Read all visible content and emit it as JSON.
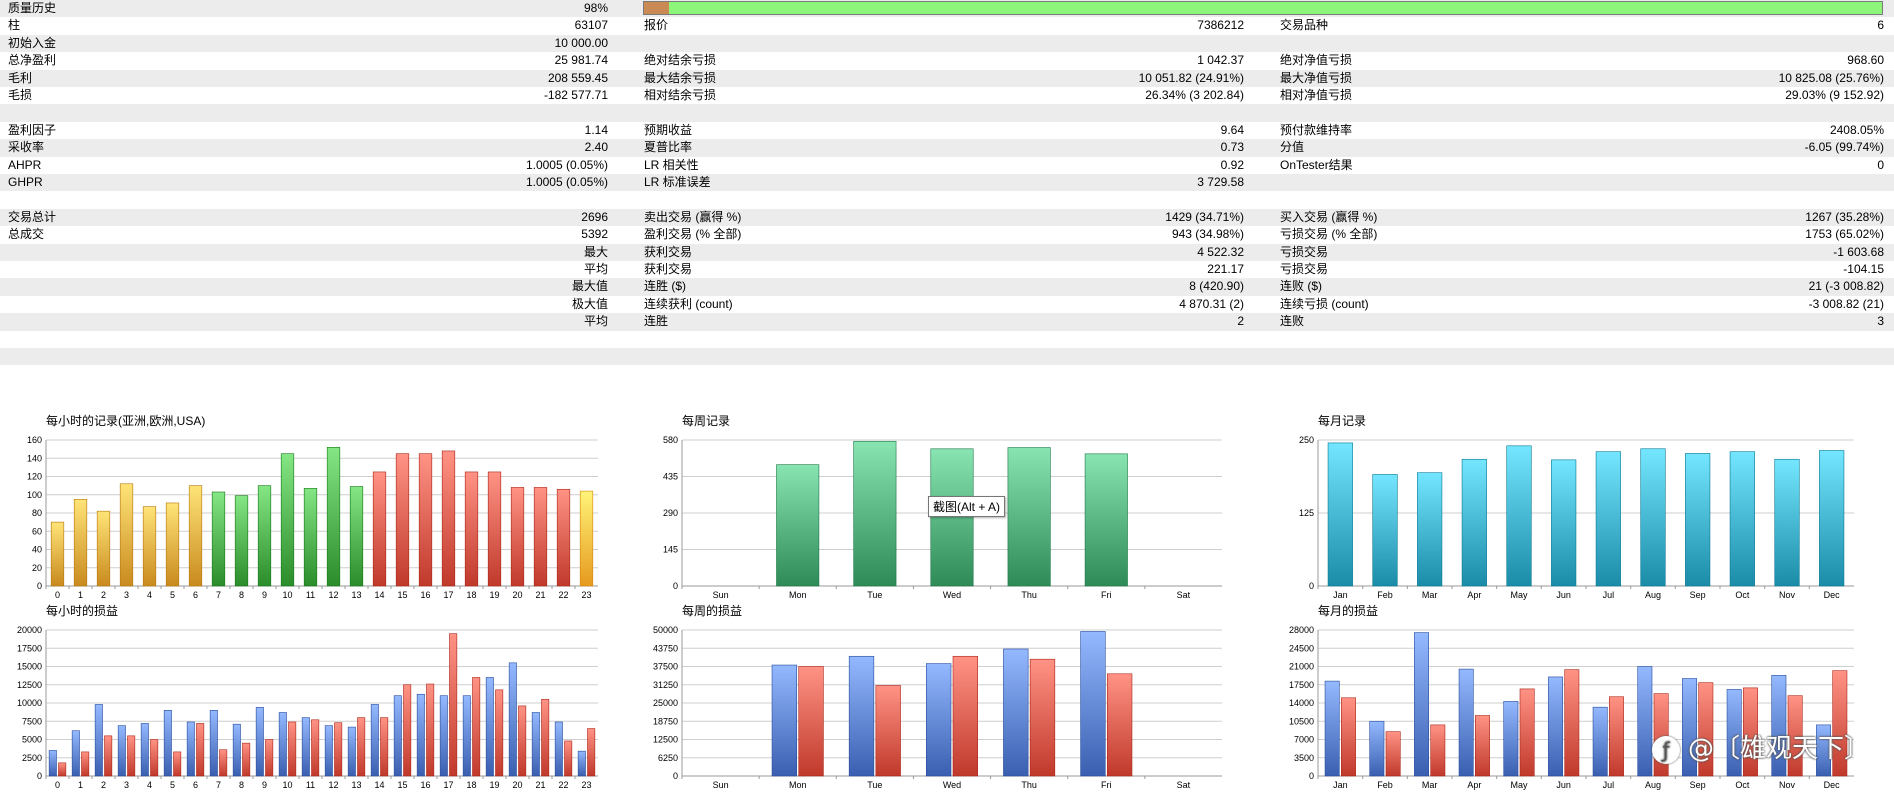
{
  "stats": {
    "rows": [
      {
        "shaded": true,
        "c1_label": "质量历史",
        "c1_value": "98%",
        "quality_bar": 0.98
      },
      {
        "shaded": false,
        "c1_label": "柱",
        "c1_value": "63107",
        "c2_label": "报价",
        "c2_value": "7386212",
        "c3_label": "交易品种",
        "c3_value": "6"
      },
      {
        "shaded": true,
        "c1_label": "初始入金",
        "c1_value": "10 000.00"
      },
      {
        "shaded": false,
        "c1_label": "总净盈利",
        "c1_value": "25 981.74",
        "c2_label": "绝对结余亏损",
        "c2_value": "1 042.37",
        "c3_label": "绝对净值亏损",
        "c3_value": "968.60"
      },
      {
        "shaded": true,
        "c1_label": "毛利",
        "c1_value": "208 559.45",
        "c2_label": "最大结余亏损",
        "c2_value": "10 051.82 (24.91%)",
        "c3_label": "最大净值亏损",
        "c3_value": "10 825.08 (25.76%)"
      },
      {
        "shaded": false,
        "c1_label": "毛损",
        "c1_value": "-182 577.71",
        "c2_label": "相对结余亏损",
        "c2_value": "26.34% (3 202.84)",
        "c3_label": "相对净值亏损",
        "c3_value": "29.03% (9 152.92)"
      },
      {
        "shaded": true
      },
      {
        "shaded": false,
        "c1_label": "盈利因子",
        "c1_value": "1.14",
        "c2_label": "预期收益",
        "c2_value": "9.64",
        "c3_label": "预付款维持率",
        "c3_value": "2408.05%"
      },
      {
        "shaded": true,
        "c1_label": "采收率",
        "c1_value": "2.40",
        "c2_label": "夏普比率",
        "c2_value": "0.73",
        "c3_label": "分值",
        "c3_value": "-6.05 (99.74%)"
      },
      {
        "shaded": false,
        "c1_label": "AHPR",
        "c1_value": "1.0005 (0.05%)",
        "c2_label": "LR 相关性",
        "c2_value": "0.92",
        "c3_label": "OnTester结果",
        "c3_value": "0"
      },
      {
        "shaded": true,
        "c1_label": "GHPR",
        "c1_value": "1.0005 (0.05%)",
        "c2_label": "LR 标准误差",
        "c2_value": "3 729.58"
      },
      {
        "shaded": false
      },
      {
        "shaded": true,
        "c1_label": "交易总计",
        "c1_value": "2696",
        "c2_label": "卖出交易 (赢得 %)",
        "c2_value": "1429 (34.71%)",
        "c3_label": "买入交易 (赢得 %)",
        "c3_value": "1267 (35.28%)"
      },
      {
        "shaded": false,
        "c1_label": "总成交",
        "c1_value": "5392",
        "c2_label": "盈利交易 (% 全部)",
        "c2_value": "943 (34.98%)",
        "c3_label": "亏损交易 (% 全部)",
        "c3_value": "1753 (65.02%)"
      },
      {
        "shaded": true,
        "c1_value": "最大",
        "c2_label": "获利交易",
        "c2_value": "4 522.32",
        "c3_label": "亏损交易",
        "c3_value": "-1 603.68"
      },
      {
        "shaded": false,
        "c1_value": "平均",
        "c2_label": "获利交易",
        "c2_value": "221.17",
        "c3_label": "亏损交易",
        "c3_value": "-104.15"
      },
      {
        "shaded": true,
        "c1_value": "最大值",
        "c2_label": "连胜 ($)",
        "c2_value": "8 (420.90)",
        "c3_label": "连败 ($)",
        "c3_value": "21 (-3 008.82)"
      },
      {
        "shaded": false,
        "c1_value": "极大值",
        "c2_label": "连续获利 (count)",
        "c2_value": "4 870.31 (2)",
        "c3_label": "连续亏损 (count)",
        "c3_value": "-3 008.82 (21)"
      },
      {
        "shaded": true,
        "c1_value": "平均",
        "c2_label": "连胜",
        "c2_value": "2",
        "c3_label": "连败",
        "c3_value": "3"
      },
      {
        "shaded": false
      },
      {
        "shaded": true
      }
    ]
  },
  "tooltip": "截图(Alt + A)",
  "watermark": "@〔雄观天下〕",
  "chart_data": [
    {
      "id": "hourly-count",
      "type": "bar",
      "title": "每小时的记录(亚洲,欧洲,USA)",
      "categories": [
        "0",
        "1",
        "2",
        "3",
        "4",
        "5",
        "6",
        "7",
        "8",
        "9",
        "10",
        "11",
        "12",
        "13",
        "14",
        "15",
        "16",
        "17",
        "18",
        "19",
        "20",
        "21",
        "22",
        "23"
      ],
      "values": [
        70,
        95,
        82,
        112,
        87,
        91,
        110,
        103,
        99,
        110,
        145,
        107,
        152,
        109,
        125,
        145,
        145,
        148,
        125,
        125,
        108,
        108,
        106,
        104
      ],
      "colors": [
        "#c98a1e",
        "#c98a1e",
        "#c98a1e",
        "#c98a1e",
        "#c98a1e",
        "#c98a1e",
        "#c98a1e",
        "#2a8c2a",
        "#2a8c2a",
        "#2a8c2a",
        "#2a8c2a",
        "#2a8c2a",
        "#2a8c2a",
        "#2a8c2a",
        "#c0392b",
        "#c0392b",
        "#c0392b",
        "#c0392b",
        "#c0392b",
        "#c0392b",
        "#c0392b",
        "#c0392b",
        "#c0392b",
        "#e69a1e"
      ],
      "yticks": [
        0,
        20,
        40,
        60,
        80,
        100,
        120,
        140,
        160
      ],
      "ylim": [
        0,
        160
      ]
    },
    {
      "id": "weekly-count",
      "type": "bar",
      "title": "每周记录",
      "categories": [
        "Sun",
        "Mon",
        "Tue",
        "Wed",
        "Thu",
        "Fri",
        "Sat"
      ],
      "values": [
        0,
        482,
        575,
        545,
        550,
        525,
        0
      ],
      "colors": [
        "#2e8b57"
      ],
      "yticks": [
        0,
        145,
        290,
        435,
        580
      ],
      "ylim": [
        0,
        580
      ]
    },
    {
      "id": "monthly-count",
      "type": "bar",
      "title": "每月记录",
      "categories": [
        "Jan",
        "Feb",
        "Mar",
        "Apr",
        "May",
        "Jun",
        "Jul",
        "Aug",
        "Sep",
        "Oct",
        "Nov",
        "Dec"
      ],
      "values": [
        245,
        191,
        194,
        217,
        240,
        216,
        230,
        235,
        227,
        230,
        217,
        232
      ],
      "colors": [
        "#1a8ca8"
      ],
      "yticks": [
        0,
        125,
        250
      ],
      "ylim": [
        0,
        250
      ]
    },
    {
      "id": "hourly-pl",
      "type": "bar",
      "title": "每小时的损益",
      "categories": [
        "0",
        "1",
        "2",
        "3",
        "4",
        "5",
        "6",
        "7",
        "8",
        "9",
        "10",
        "11",
        "12",
        "13",
        "14",
        "15",
        "16",
        "17",
        "18",
        "19",
        "20",
        "21",
        "22",
        "23"
      ],
      "series": [
        {
          "values": [
            3500,
            6200,
            9800,
            6900,
            7200,
            9000,
            7400,
            9000,
            7100,
            9400,
            8700,
            8000,
            6900,
            6700,
            9800,
            11000,
            11200,
            11000,
            11000,
            13500,
            15500,
            8700,
            7400,
            3400
          ],
          "color": "#3a5fb0"
        },
        {
          "values": [
            1800,
            3300,
            5500,
            5500,
            5000,
            3300,
            7200,
            3600,
            4500,
            5000,
            7400,
            7700,
            7300,
            8000,
            8000,
            12500,
            12600,
            19500,
            13500,
            11800,
            9600,
            10500,
            4800,
            6500
          ],
          "color": "#c0392b"
        }
      ],
      "yticks": [
        0,
        2500,
        5000,
        7500,
        10000,
        12500,
        15000,
        17500,
        20000
      ],
      "ylim": [
        0,
        20000
      ]
    },
    {
      "id": "weekly-pl",
      "type": "bar",
      "title": "每周的损益",
      "categories": [
        "Sun",
        "Mon",
        "Tue",
        "Wed",
        "Thu",
        "Fri",
        "Sat"
      ],
      "series": [
        {
          "values": [
            0,
            38000,
            41000,
            38500,
            43500,
            49500,
            0
          ],
          "color": "#3a5fb0"
        },
        {
          "values": [
            0,
            37500,
            31000,
            41000,
            40000,
            35000,
            0
          ],
          "color": "#c0392b"
        }
      ],
      "yticks": [
        0,
        6250,
        12500,
        18750,
        25000,
        31250,
        37500,
        43750,
        50000
      ],
      "ylim": [
        0,
        50000
      ]
    },
    {
      "id": "monthly-pl",
      "type": "bar",
      "title": "每月的损益",
      "categories": [
        "Jan",
        "Feb",
        "Mar",
        "Apr",
        "May",
        "Jun",
        "Jul",
        "Aug",
        "Sep",
        "Oct",
        "Nov",
        "Dec"
      ],
      "series": [
        {
          "values": [
            18200,
            10500,
            27500,
            20500,
            14300,
            19000,
            13200,
            21000,
            18700,
            16600,
            19300,
            9800
          ],
          "color": "#3a5fb0"
        },
        {
          "values": [
            15000,
            8500,
            9800,
            11600,
            16700,
            20400,
            15200,
            15800,
            17900,
            16900,
            15400,
            20200
          ],
          "color": "#c0392b"
        }
      ],
      "yticks": [
        0,
        3500,
        7000,
        10500,
        14000,
        17500,
        21000,
        24500,
        28000
      ],
      "ylim": [
        0,
        28000
      ]
    }
  ]
}
